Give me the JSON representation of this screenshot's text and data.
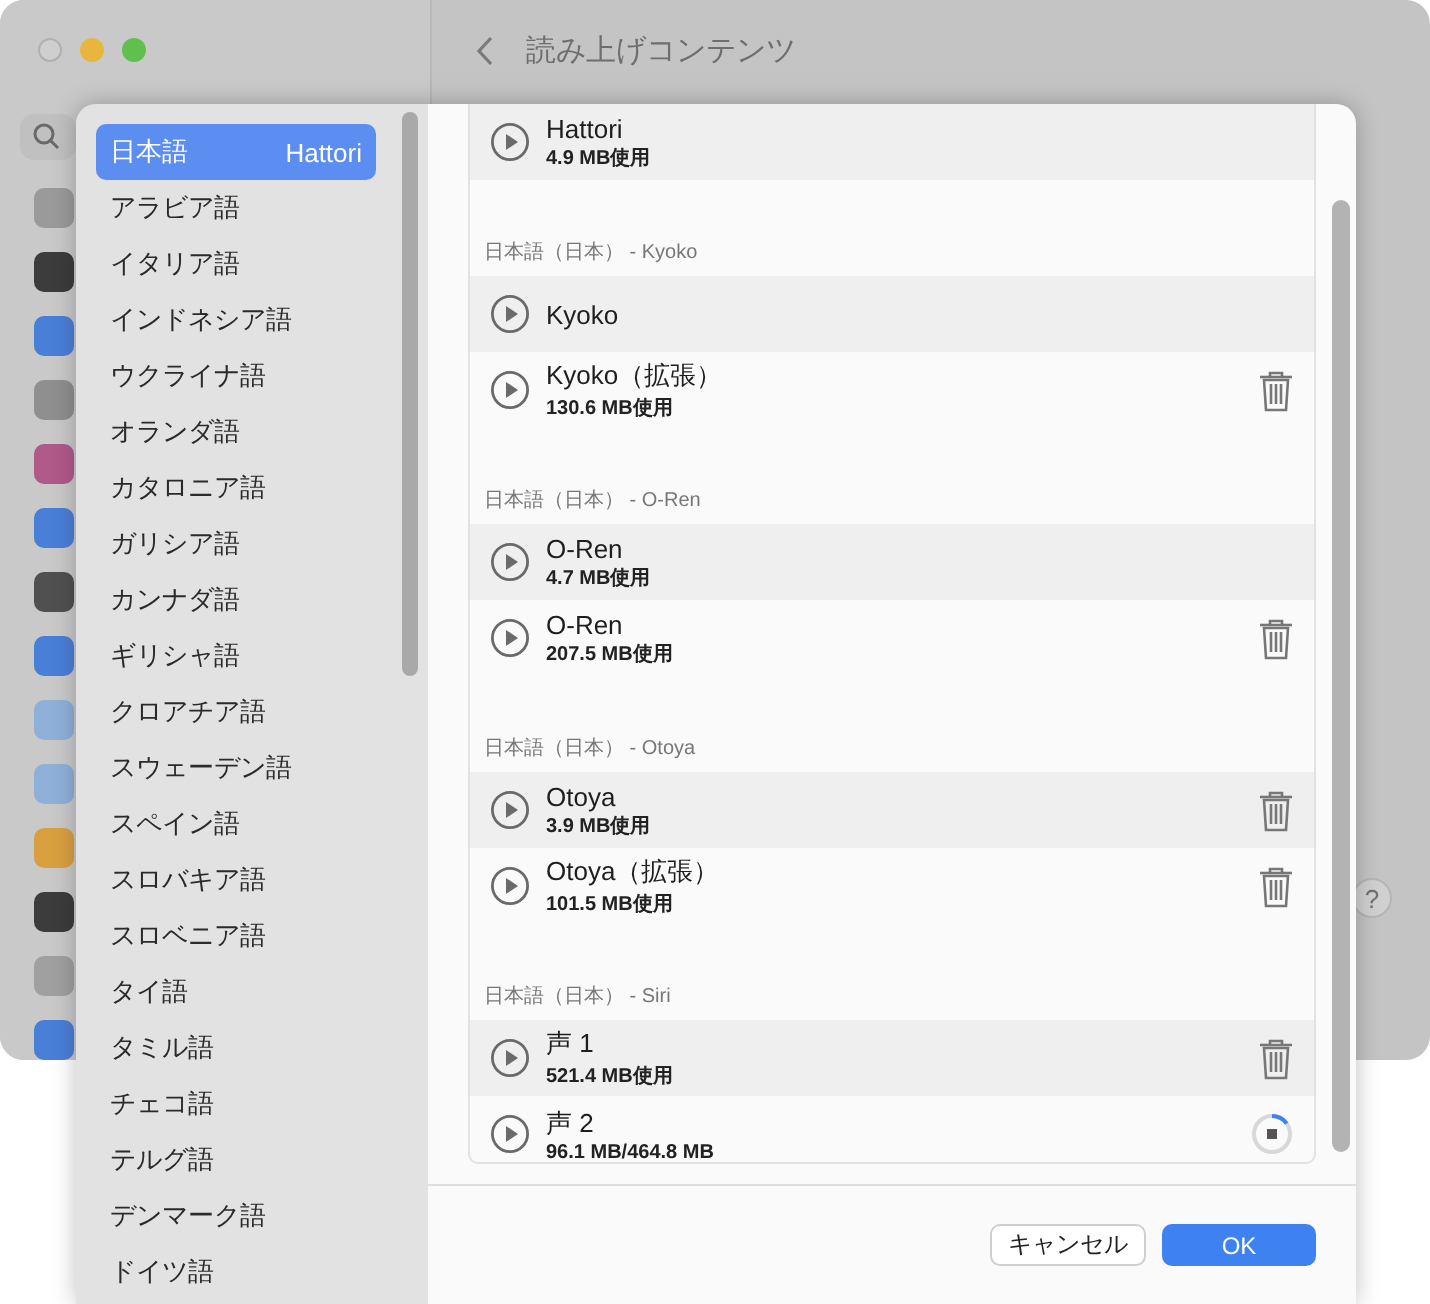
{
  "window": {
    "title": "読み上げコンテンツ"
  },
  "help_button": {
    "label": "?"
  },
  "languages": [
    {
      "label": "日本語",
      "voice": "Hattori",
      "selected": true
    },
    {
      "label": "アラビア語",
      "selected": false
    },
    {
      "label": "イタリア語",
      "selected": false
    },
    {
      "label": "インドネシア語",
      "selected": false
    },
    {
      "label": "ウクライナ語",
      "selected": false
    },
    {
      "label": "オランダ語",
      "selected": false
    },
    {
      "label": "カタロニア語",
      "selected": false
    },
    {
      "label": "ガリシア語",
      "selected": false
    },
    {
      "label": "カンナダ語",
      "selected": false
    },
    {
      "label": "ギリシャ語",
      "selected": false
    },
    {
      "label": "クロアチア語",
      "selected": false
    },
    {
      "label": "スウェーデン語",
      "selected": false
    },
    {
      "label": "スペイン語",
      "selected": false
    },
    {
      "label": "スロバキア語",
      "selected": false
    },
    {
      "label": "スロベニア語",
      "selected": false
    },
    {
      "label": "タイ語",
      "selected": false
    },
    {
      "label": "タミル語",
      "selected": false
    },
    {
      "label": "チェコ語",
      "selected": false
    },
    {
      "label": "テルグ語",
      "selected": false
    },
    {
      "label": "デンマーク語",
      "selected": false
    },
    {
      "label": "ドイツ語",
      "selected": false
    }
  ],
  "voice_groups": [
    {
      "voices": [
        {
          "name": "Hattori",
          "size": "4.9 MB使用",
          "kind": "plain"
        }
      ]
    },
    {
      "header": "日本語（日本） - Kyoko",
      "voices": [
        {
          "name": "Kyoko",
          "kind": "plain"
        },
        {
          "name": "Kyoko（拡張）",
          "size": "130.6 MB使用",
          "kind": "deletable"
        }
      ]
    },
    {
      "header": "日本語（日本） - O-Ren",
      "voices": [
        {
          "name": "O-Ren",
          "size": "4.7 MB使用",
          "kind": "plain"
        },
        {
          "name": "O-Ren",
          "size": "207.5 MB使用",
          "kind": "deletable"
        }
      ]
    },
    {
      "header": "日本語（日本） - Otoya",
      "voices": [
        {
          "name": "Otoya",
          "size": "3.9 MB使用",
          "kind": "deletable"
        },
        {
          "name": "Otoya（拡張）",
          "size": "101.5 MB使用",
          "kind": "deletable"
        }
      ]
    },
    {
      "header": "日本語（日本） - Siri",
      "voices": [
        {
          "name": "声 1",
          "size": "521.4 MB使用",
          "kind": "deletable"
        },
        {
          "name": "声 2",
          "size": "96.1 MB/464.8 MB",
          "kind": "downloading",
          "level": 0.15
        }
      ]
    }
  ],
  "buttons": [
    {
      "label": "キャンセル",
      "kind": "secondary"
    },
    {
      "label": "OK",
      "kind": "primary"
    }
  ]
}
